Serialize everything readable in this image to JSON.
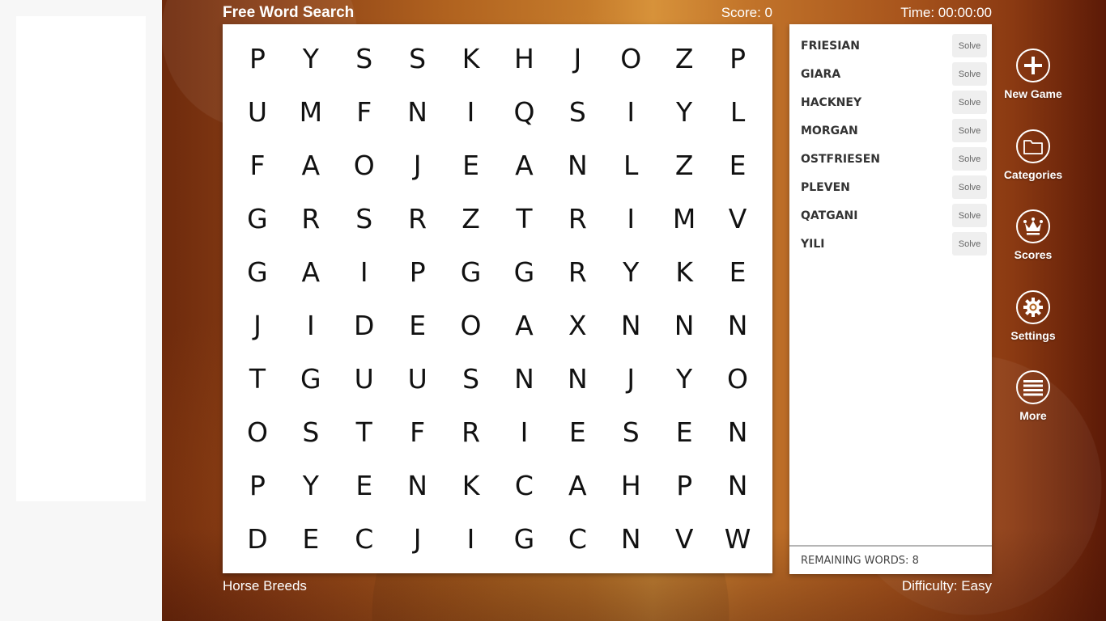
{
  "header": {
    "title": "Free Word Search",
    "score": "Score: 0",
    "time": "Time: 00:00:00"
  },
  "grid": [
    [
      "P",
      "Y",
      "S",
      "S",
      "K",
      "H",
      "J",
      "O",
      "Z",
      "P"
    ],
    [
      "U",
      "M",
      "F",
      "N",
      "I",
      "Q",
      "S",
      "I",
      "Y",
      "L"
    ],
    [
      "F",
      "A",
      "O",
      "J",
      "E",
      "A",
      "N",
      "L",
      "Z",
      "E"
    ],
    [
      "G",
      "R",
      "S",
      "R",
      "Z",
      "T",
      "R",
      "I",
      "M",
      "V"
    ],
    [
      "G",
      "A",
      "I",
      "P",
      "G",
      "G",
      "R",
      "Y",
      "K",
      "E"
    ],
    [
      "J",
      "I",
      "D",
      "E",
      "O",
      "A",
      "X",
      "N",
      "N",
      "N"
    ],
    [
      "T",
      "G",
      "U",
      "U",
      "S",
      "N",
      "N",
      "J",
      "Y",
      "O"
    ],
    [
      "O",
      "S",
      "T",
      "F",
      "R",
      "I",
      "E",
      "S",
      "E",
      "N"
    ],
    [
      "P",
      "Y",
      "E",
      "N",
      "K",
      "C",
      "A",
      "H",
      "P",
      "N"
    ],
    [
      "D",
      "E",
      "C",
      "J",
      "I",
      "G",
      "C",
      "N",
      "V",
      "W"
    ]
  ],
  "words": [
    {
      "word": "FRIESIAN",
      "solve_label": "Solve"
    },
    {
      "word": "GIARA",
      "solve_label": "Solve"
    },
    {
      "word": "HACKNEY",
      "solve_label": "Solve"
    },
    {
      "word": "MORGAN",
      "solve_label": "Solve"
    },
    {
      "word": "OSTFRIESEN",
      "solve_label": "Solve"
    },
    {
      "word": "PLEVEN",
      "solve_label": "Solve"
    },
    {
      "word": "QATGANI",
      "solve_label": "Solve"
    },
    {
      "word": "YILI",
      "solve_label": "Solve"
    }
  ],
  "remaining": "REMAINING WORDS: 8",
  "footer": {
    "category": "Horse Breeds",
    "difficulty": "Difficulty: Easy"
  },
  "menu": [
    {
      "id": "new-game",
      "label": "New Game",
      "icon": "plus-icon"
    },
    {
      "id": "categories",
      "label": "Categories",
      "icon": "folder-icon"
    },
    {
      "id": "scores",
      "label": "Scores",
      "icon": "crown-icon"
    },
    {
      "id": "settings",
      "label": "Settings",
      "icon": "gear-icon"
    },
    {
      "id": "more",
      "label": "More",
      "icon": "menu-lines-icon"
    }
  ]
}
